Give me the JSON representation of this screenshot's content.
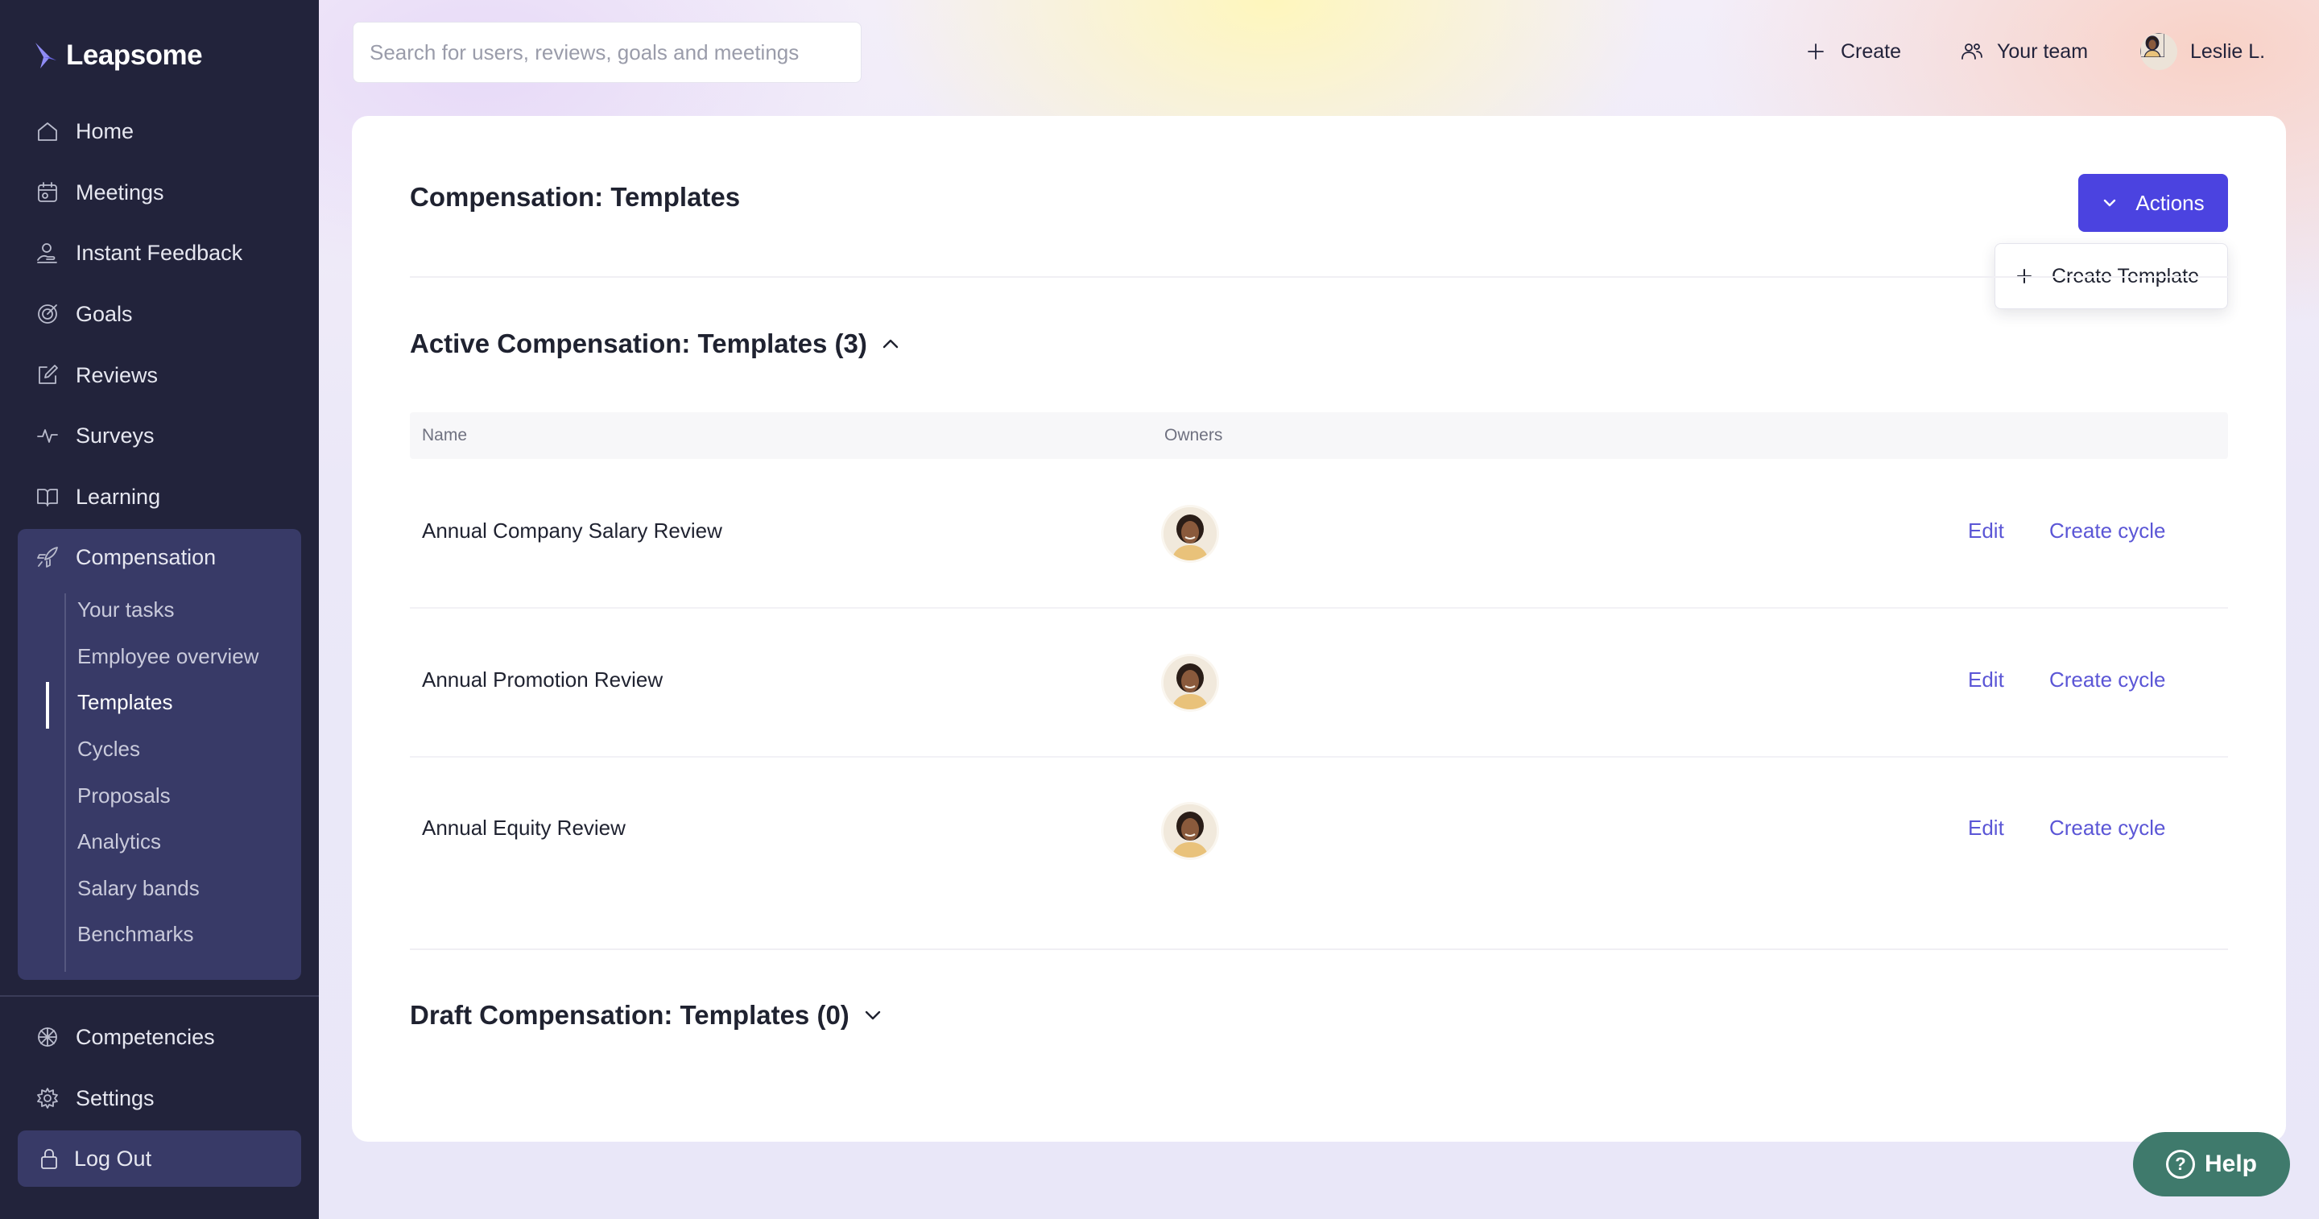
{
  "app": {
    "name": "Leapsome"
  },
  "search": {
    "placeholder": "Search for users, reviews, goals and meetings"
  },
  "topbar": {
    "create_label": "Create",
    "team_label": "Your team",
    "user_label": "Leslie L."
  },
  "sidebar": {
    "items": [
      {
        "label": "Home",
        "icon": "home-icon"
      },
      {
        "label": "Meetings",
        "icon": "meetings-icon"
      },
      {
        "label": "Instant Feedback",
        "icon": "feedback-icon"
      },
      {
        "label": "Goals",
        "icon": "target-icon"
      },
      {
        "label": "Reviews",
        "icon": "edit-icon"
      },
      {
        "label": "Surveys",
        "icon": "pulse-icon"
      },
      {
        "label": "Learning",
        "icon": "book-icon"
      },
      {
        "label": "Compensation",
        "icon": "rocket-icon"
      }
    ],
    "compensation_sub": [
      {
        "label": "Your tasks"
      },
      {
        "label": "Employee overview"
      },
      {
        "label": "Templates",
        "active": true
      },
      {
        "label": "Cycles"
      },
      {
        "label": "Proposals"
      },
      {
        "label": "Analytics"
      },
      {
        "label": "Salary bands"
      },
      {
        "label": "Benchmarks"
      }
    ],
    "bottom_items": [
      {
        "label": "Competencies",
        "icon": "competencies-icon"
      },
      {
        "label": "Settings",
        "icon": "gear-icon"
      }
    ],
    "logout_label": "Log Out"
  },
  "main": {
    "title": "Compensation: Templates",
    "actions_label": "Actions",
    "dropdown_item": "Create Template",
    "active_section": "Active Compensation: Templates (3)",
    "draft_section": "Draft Compensation: Templates (0)",
    "columns": {
      "name": "Name",
      "owners": "Owners"
    },
    "rows": [
      {
        "name": "Annual Company Salary Review",
        "edit": "Edit",
        "create_cycle": "Create cycle"
      },
      {
        "name": "Annual Promotion Review",
        "edit": "Edit",
        "create_cycle": "Create cycle"
      },
      {
        "name": "Annual Equity Review",
        "edit": "Edit",
        "create_cycle": "Create cycle"
      }
    ]
  },
  "help": {
    "label": "Help"
  },
  "colors": {
    "sidebar_bg": "#22233b",
    "sidebar_active_bg": "#383a67",
    "accent": "#4b43e0",
    "link": "#5b56d6",
    "help_bg": "#3f7a6c"
  }
}
